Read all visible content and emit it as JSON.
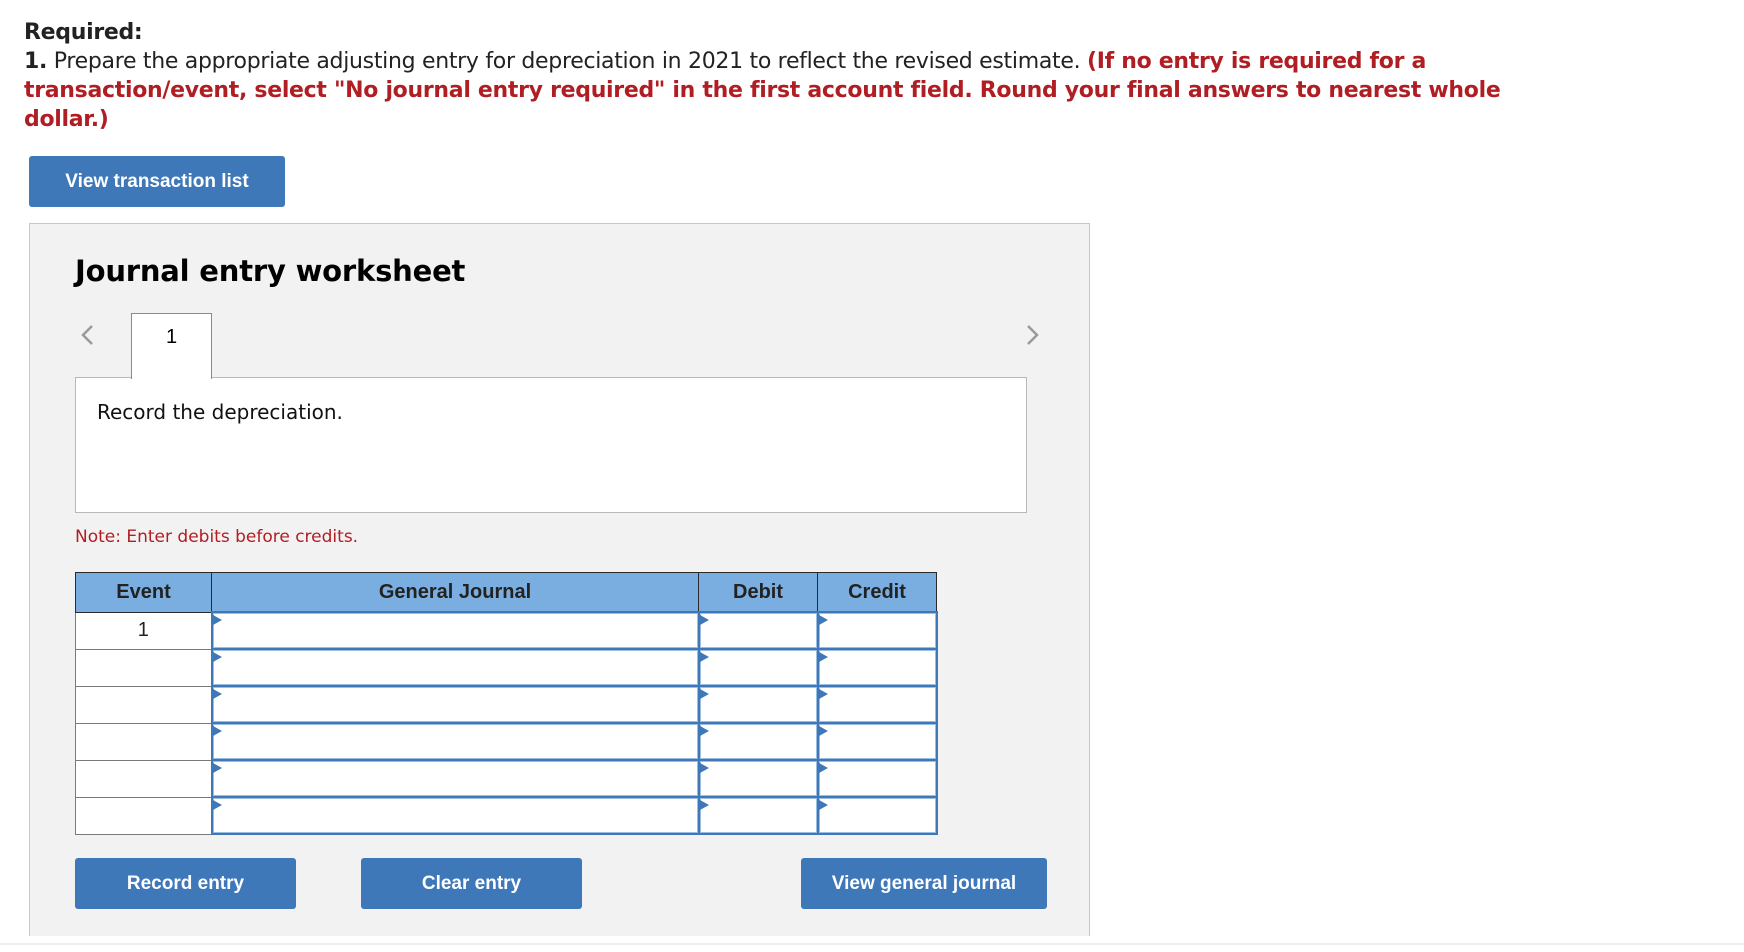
{
  "instructions": {
    "required_label": "Required:",
    "item_number": "1.",
    "item_text": " Prepare the appropriate adjusting entry for depreciation in 2021 to reflect the revised estimate. ",
    "item_note": "(If no entry is required for a transaction/event, select \"No journal entry required\" in the first account field. Round your final answers to nearest whole dollar.)"
  },
  "buttons": {
    "view_transaction_list": "View transaction list",
    "record_entry": "Record entry",
    "clear_entry": "Clear entry",
    "view_general_journal": "View general journal"
  },
  "worksheet": {
    "title": "Journal entry worksheet",
    "tabs": [
      {
        "label": "1",
        "active": true
      }
    ],
    "prev_icon": "chevron-left-icon",
    "next_icon": "chevron-right-icon",
    "description": "Record the depreciation.",
    "note": "Note: Enter debits before credits."
  },
  "table": {
    "headers": [
      "Event",
      "General Journal",
      "Debit",
      "Credit"
    ],
    "rows": [
      {
        "event": "1",
        "account": "",
        "debit": "",
        "credit": ""
      },
      {
        "event": "",
        "account": "",
        "debit": "",
        "credit": ""
      },
      {
        "event": "",
        "account": "",
        "debit": "",
        "credit": ""
      },
      {
        "event": "",
        "account": "",
        "debit": "",
        "credit": ""
      },
      {
        "event": "",
        "account": "",
        "debit": "",
        "credit": ""
      },
      {
        "event": "",
        "account": "",
        "debit": "",
        "credit": ""
      }
    ]
  },
  "colors": {
    "accent_blue": "#3e78b9",
    "header_blue": "#7aaee0",
    "instruction_red": "#b01e23",
    "panel_bg": "#f2f2f2"
  }
}
